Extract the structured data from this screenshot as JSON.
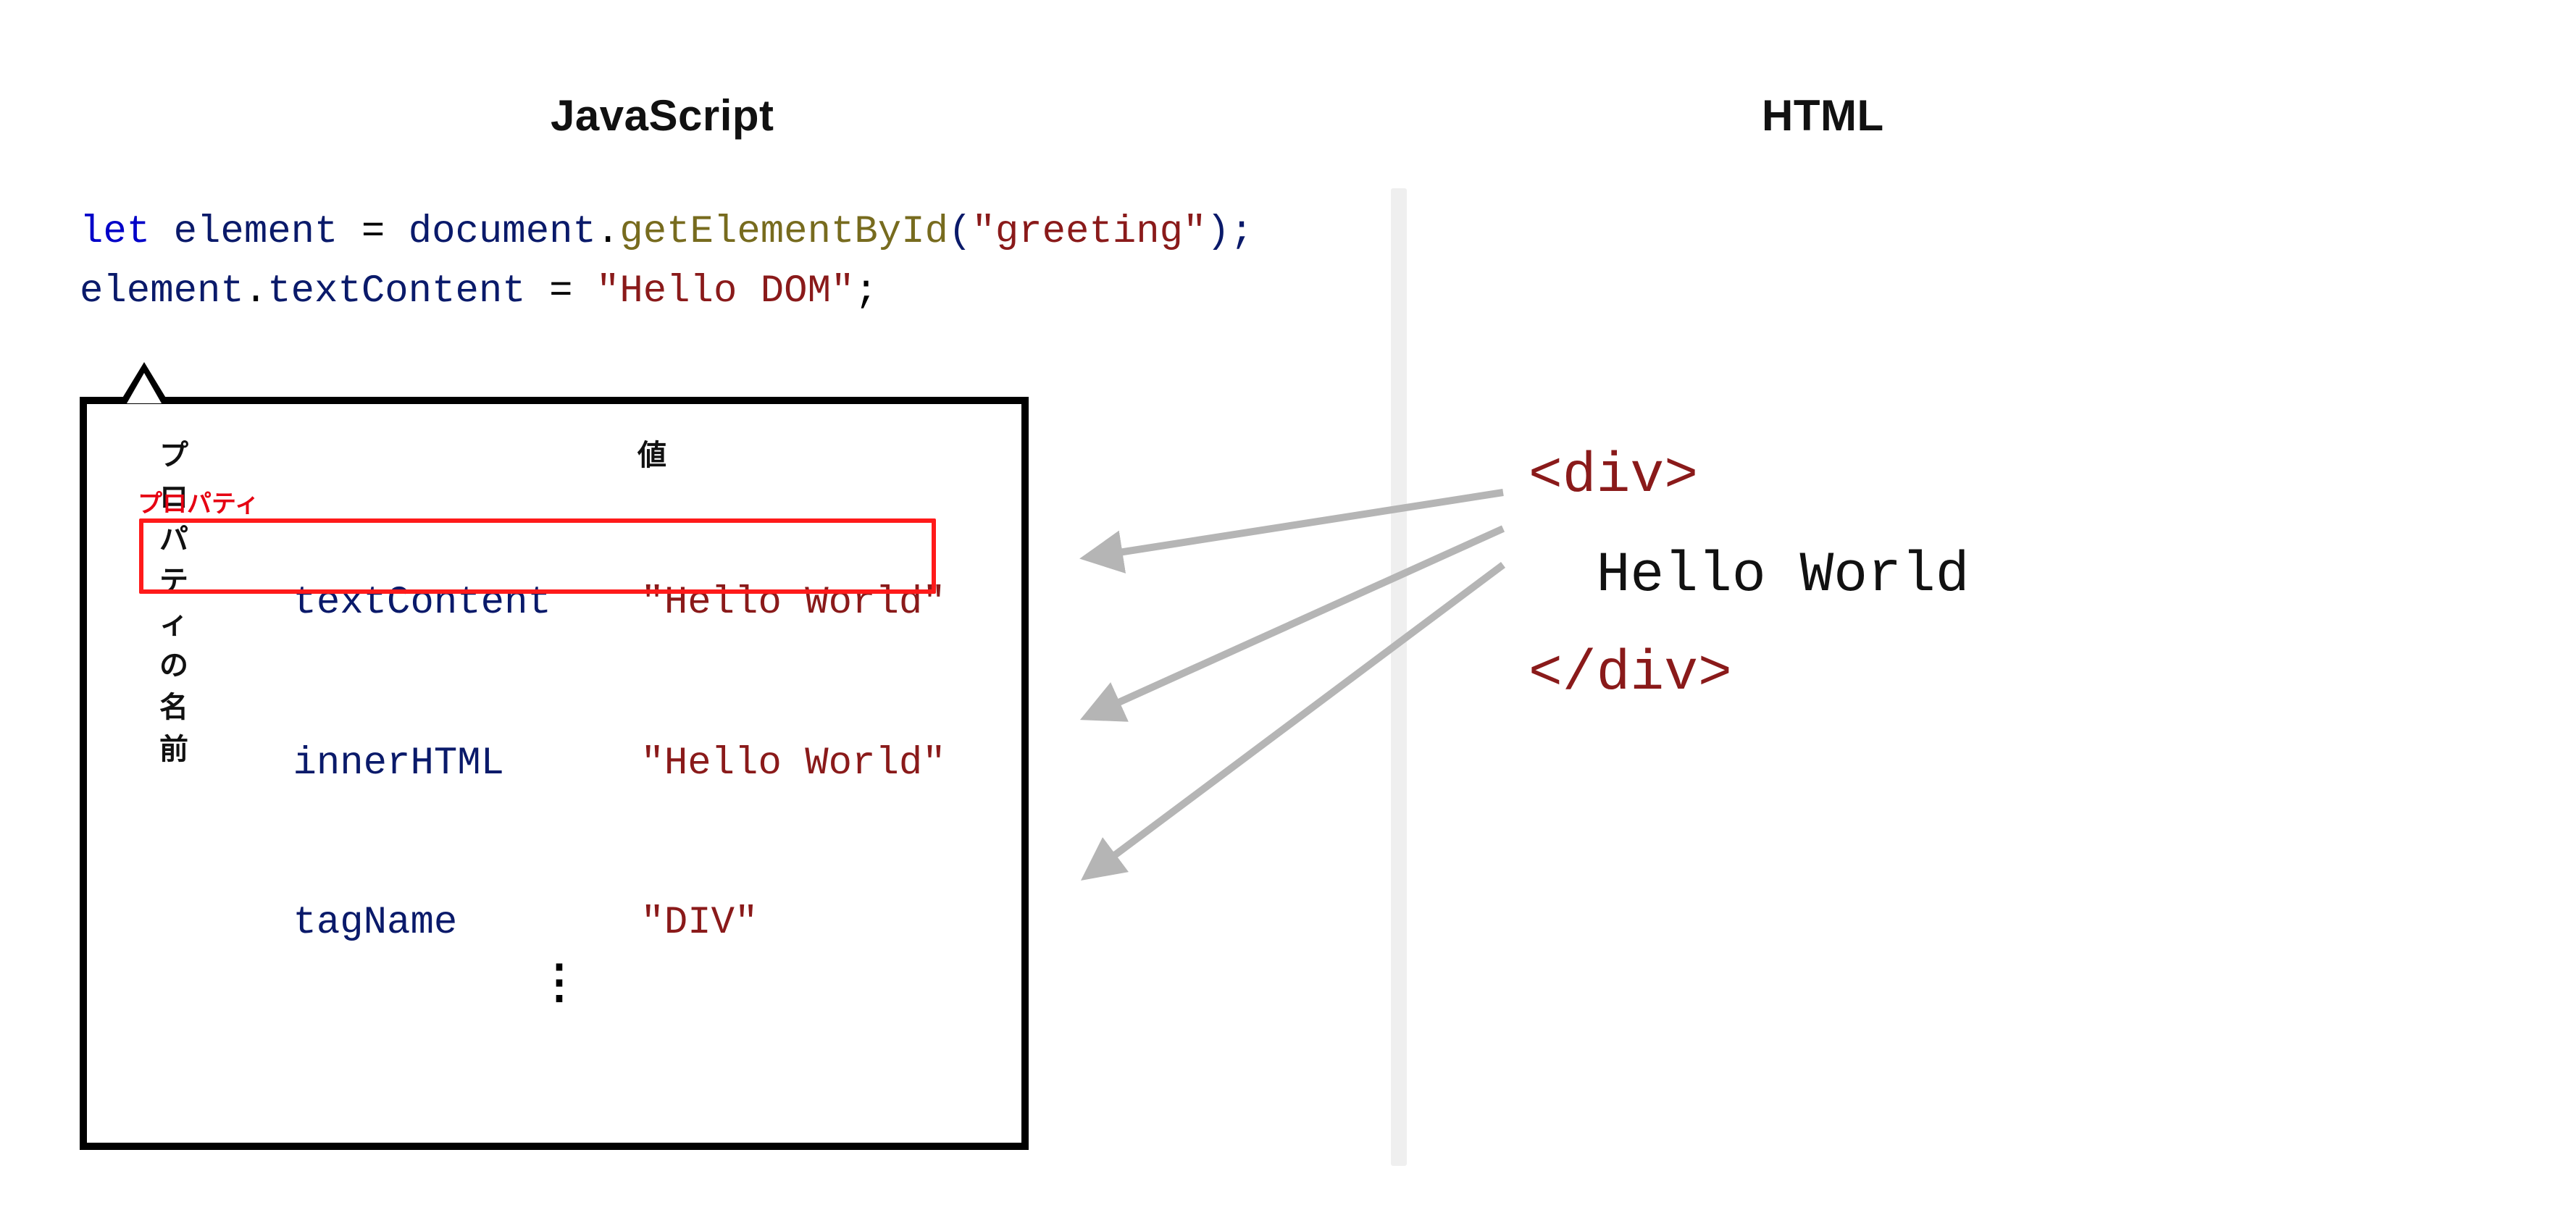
{
  "headings": {
    "js": "JavaScript",
    "html": "HTML"
  },
  "code": {
    "let": "let",
    "elementVar": "element",
    "assign": " = ",
    "document": "document",
    "dot": ".",
    "getElementById": "getElementById",
    "openParen": "(",
    "greeting": "\"greeting\"",
    "closeParenSemi": ");",
    "elementVar2": "element",
    "textContent": "textContent",
    "assign2": " = ",
    "helloDom": "\"Hello DOM\"",
    "semi": ";"
  },
  "propBox": {
    "headerName": "プロパティの名前",
    "headerValue": "値",
    "propertyLabel": "プロパティ",
    "rows": [
      {
        "name": "textContent",
        "value": "\"Hello World\""
      },
      {
        "name": "innerHTML",
        "value": "\"Hello World\""
      },
      {
        "name": "tagName",
        "value": "\"DIV\""
      }
    ],
    "vdots": "⋮"
  },
  "htmlSide": {
    "openTag": "<div>",
    "textIndent": "  ",
    "text": "Hello World",
    "closeTag": "</div>"
  }
}
